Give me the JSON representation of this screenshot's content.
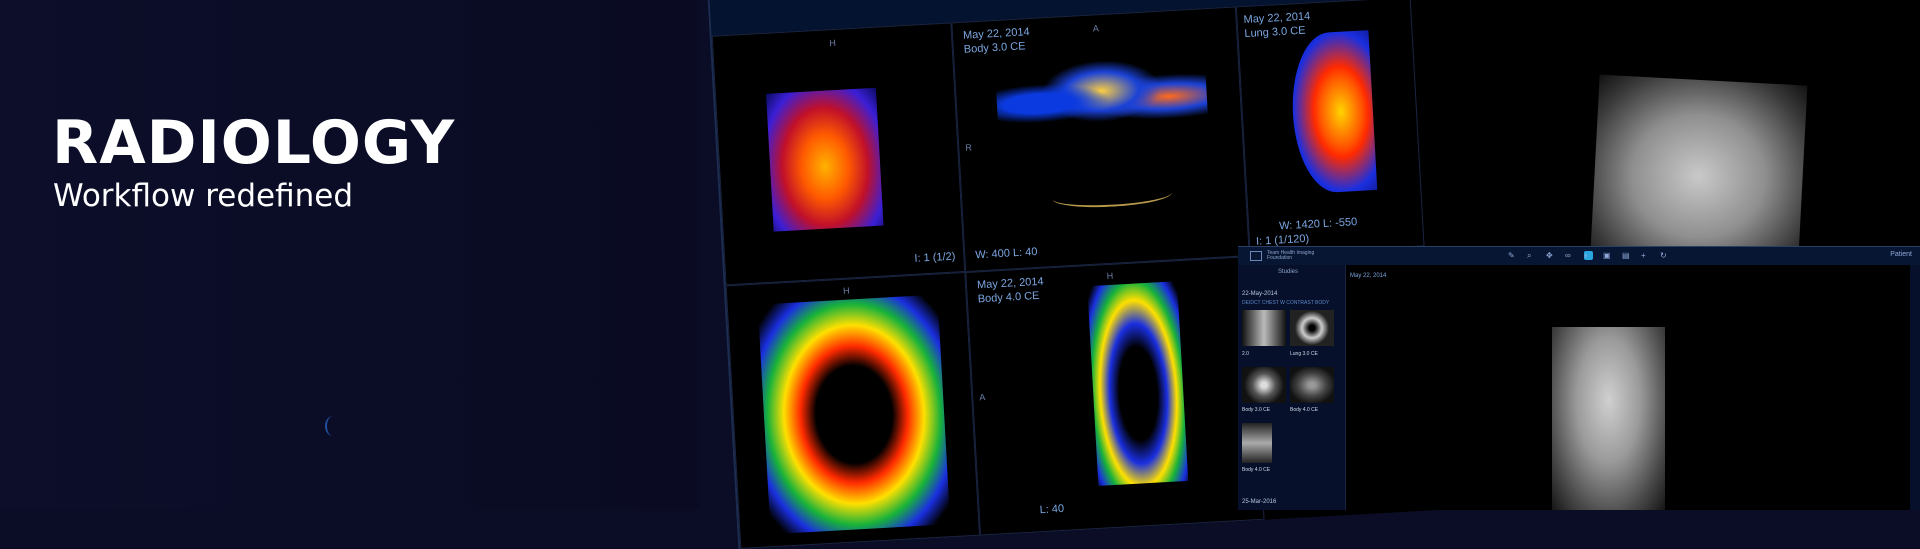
{
  "hero": {
    "title": "RADIOLOGY",
    "subtitle": "Workflow redefined"
  },
  "viewer": {
    "panes": [
      {
        "orient_top": "H",
        "footer": "I: 1 (1/2)"
      },
      {
        "date": "May 22, 2014",
        "series": "Body 3.0 CE",
        "orient_top": "A",
        "orient_left": "R",
        "footer": "W: 400  L: 40"
      },
      {
        "date": "May 22, 2014",
        "series": "Lung 3.0 CE",
        "footer_wl": "W: 1420  L: -550",
        "footer": "I: 1 (1/120)"
      },
      {
        "orient_top": "H"
      },
      {
        "date": "May 22, 2014",
        "series": "Body 4.0 CE",
        "orient_top": "H",
        "orient_left": "A",
        "footer": "L: 40"
      }
    ]
  },
  "app": {
    "brand": "Team Health Imaging Foundation",
    "sidebar_header": "Studies",
    "study_date": "22-May-2014",
    "study_desc": "DEIDCT CHEST W CONTRAST BODY",
    "thumbs": [
      {
        "label": "2.0"
      },
      {
        "label": "Lung 3.0 CE"
      },
      {
        "label": "Body 3.0 CE"
      },
      {
        "label": "Body 4.0 CE"
      },
      {
        "label": "Body 4.0 CE"
      }
    ],
    "second_date": "25-Mar-2016",
    "main_date": "May 22, 2014",
    "right_label": "Patient"
  }
}
